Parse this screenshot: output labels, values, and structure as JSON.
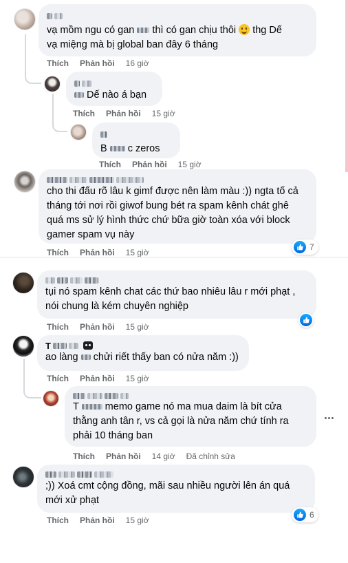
{
  "actions": {
    "like": "Thích",
    "reply": "Phản hồi"
  },
  "colors": {
    "bubble": "#f0f2f5",
    "meta": "#65676b",
    "like_blue": "#0866ff"
  },
  "comments": [
    {
      "time": "16 giờ",
      "text_1": "vạ mồm ngu có gan",
      "text_2": "thì có gan chịu thôi",
      "text_3": "thg Dế",
      "text_line2": "vạ miệng mà bị global ban đây 6 tháng",
      "emoji": "grinning-face-emoji"
    },
    {
      "time": "15 giờ",
      "text": "Dế nào á bạn"
    },
    {
      "time": "15 giờ",
      "text_prefix": "B",
      "text_mid": "c zeros"
    },
    {
      "time": "15 giờ",
      "reactions": "7",
      "lines": [
        "cho thi đấu rõ lâu k gimf được nên làm màu :)) ngta tố cả",
        "tháng tới nơi rồi giwof bung bét ra spam kênh chát ghê",
        "quá ms sử lý hình thức chứ bữa giờ toàn xóa với block",
        "gamer spam vụ này"
      ]
    },
    {
      "time": "15 giờ",
      "lines": [
        "tụi nó spam kênh chat các thứ bao nhiêu lâu r mới phạt ,",
        "nói chung là kém chuyên nghiệp"
      ]
    },
    {
      "time": "15 giờ",
      "name_initial": "T",
      "text_1": "ao làng",
      "text_2": "chửi riết thấy ban có nửa năm :))"
    },
    {
      "time": "14 giờ",
      "edited": "Đã chỉnh sửa",
      "line1_prefix": "T",
      "line1_text": "memo game nó ma mua daim là bít cửa",
      "lines": [
        "thằng anh tân r, vs cả gọi là nửa năm chứ tính ra",
        "phải 10 tháng ban"
      ]
    },
    {
      "time": "15 giờ",
      "reactions": "6",
      "lines": [
        ";)) Xoá cmt cộng đồng, mãi sau nhiều người lên án quá",
        "mới xử phạt"
      ]
    }
  ]
}
